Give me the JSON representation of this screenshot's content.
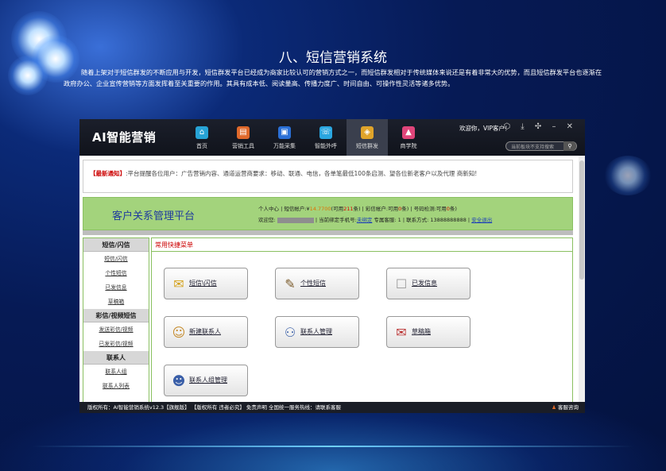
{
  "slide": {
    "title": "八、短信营销系统",
    "paragraph": "随着上架对于短信群发的不断应用与开发，短信群发平台已经成为商家比较认可的营销方式之一，而短信群发相对于传统媒体来说还是有着非常大的优势，而且短信群发平台也逐渐在政府办公、企业宣传营销等方面发挥着至关重要的作用。其具有成本低、阅读量高、传播力度广、时间自由、可操作性灵活等诸多优势。"
  },
  "app": {
    "logo": "AI智能营销",
    "nav": [
      {
        "label": "首页",
        "icon": "home-icon",
        "color": "#27a3d6",
        "glyph": "⌂"
      },
      {
        "label": "营销工具",
        "icon": "briefcase-icon",
        "color": "#e0692b",
        "glyph": "▤"
      },
      {
        "label": "万能采集",
        "icon": "bag-icon",
        "color": "#2a6fd6",
        "glyph": "▣"
      },
      {
        "label": "智能外呼",
        "icon": "phone-icon",
        "color": "#2aa6e0",
        "glyph": "☏"
      },
      {
        "label": "短信群发",
        "icon": "sms-icon",
        "color": "#e0a42a",
        "glyph": "◈"
      },
      {
        "label": "商学院",
        "icon": "graduation-icon",
        "color": "#e0457a",
        "glyph": "▲"
      }
    ],
    "welcome": "欢迎你，VIP客户！",
    "window_controls": "⬡ ⤓ ✣ – ✕",
    "search_placeholder": "当前板块不支持搜索",
    "notice_label": "【最新通知】",
    "notice_text": ":平台提醒各位用户：广告营销内容、通道运营商要求：移动、联通、电信，各单笔最低100条启测、望各位新老客户以及代理 商新知!",
    "crm": {
      "title": "客户关系管理平台",
      "line1_a": "个人中心 | 短信帐户:¥",
      "sms_balance": "14.7700",
      "line1_b": "(可用",
      "sms_count": "211",
      "line1_c": "条) | 彩信帐户:可用",
      "mms_count": "0",
      "line1_d": "条) | 号码检测:可用",
      "check_count": "0",
      "line1_e": "条)",
      "line2_a": "欢迎您:",
      "line2_b": "| 当前绑定手机号:",
      "unbound": "未绑定",
      "line2_c": "专属客服: 1 | 联系方式: 13888888888 |",
      "logout": "安全退出"
    },
    "sidebar": [
      {
        "header": "短信/闪信",
        "items": [
          "短信/闪信",
          "个性短信",
          "已发信息",
          "草稿箱"
        ]
      },
      {
        "header": "彩信/视频短信",
        "items": [
          "发送彩信/视频",
          "已发彩信/视频"
        ]
      },
      {
        "header": "联系人",
        "items": [
          "联系人组",
          "联系人列表"
        ]
      }
    ],
    "quick_menu": {
      "title": "常用快捷菜单",
      "buttons": [
        {
          "label": "短信\\闪信",
          "icon": "sms-envelope-icon",
          "glyph": "✉"
        },
        {
          "label": "个性短信",
          "icon": "personal-sms-icon",
          "glyph": "✎"
        },
        {
          "label": "已发信息",
          "icon": "sent-message-icon",
          "glyph": "☐"
        },
        {
          "label": "新建联系人",
          "icon": "new-contact-icon",
          "glyph": "☺"
        },
        {
          "label": "联系人管理",
          "icon": "contacts-manage-icon",
          "glyph": "⚇"
        },
        {
          "label": "草稿箱",
          "icon": "drafts-icon",
          "glyph": "✉"
        },
        {
          "label": "联系人组管理",
          "icon": "contact-group-icon",
          "glyph": "☻"
        }
      ]
    },
    "status": {
      "left": "版权所有：AI智能营销系统v12.3【旗舰版】 【版权所有 违者必究】       免责声明       全国统一服务热线：请联系客服",
      "right": "客服咨询"
    }
  }
}
